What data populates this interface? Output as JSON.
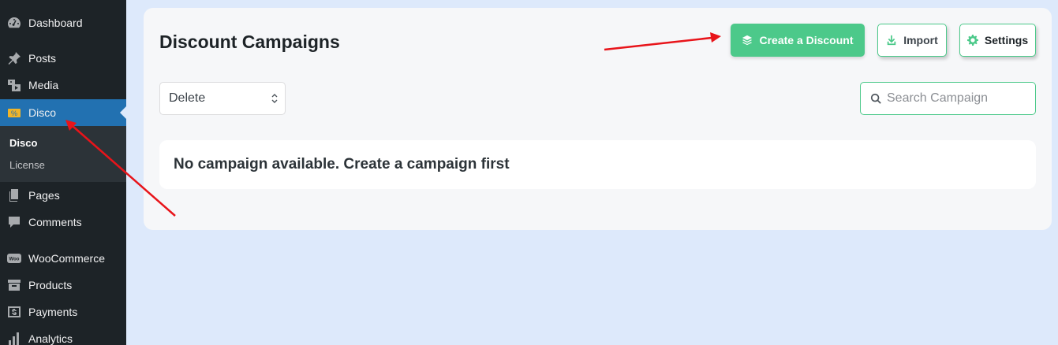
{
  "sidebar": {
    "items": [
      {
        "label": "Dashboard",
        "icon": "dashboard-icon"
      },
      {
        "label": "Posts",
        "icon": "pin-icon"
      },
      {
        "label": "Media",
        "icon": "media-icon"
      },
      {
        "label": "Disco",
        "icon": "disco-icon",
        "active": true
      },
      {
        "label": "Pages",
        "icon": "pages-icon"
      },
      {
        "label": "Comments",
        "icon": "comment-icon"
      },
      {
        "label": "WooCommerce",
        "icon": "woo-icon"
      },
      {
        "label": "Products",
        "icon": "archive-icon"
      },
      {
        "label": "Payments",
        "icon": "dollar-icon"
      },
      {
        "label": "Analytics",
        "icon": "chart-icon"
      }
    ],
    "submenu": [
      {
        "label": "Disco",
        "current": true
      },
      {
        "label": "License"
      }
    ]
  },
  "main": {
    "title": "Discount Campaigns",
    "buttons": {
      "create": "Create a Discount",
      "import": "Import",
      "settings": "Settings"
    },
    "bulk_action": {
      "selected": "Delete"
    },
    "search": {
      "placeholder": "Search Campaign"
    },
    "empty_message": "No campaign available. Create a campaign first"
  },
  "colors": {
    "sidebar_bg": "#1d2327",
    "active_bg": "#2271b1",
    "accent_green": "#4cc98a",
    "page_bg": "#dde9fb",
    "annotation_red": "#e8141a"
  }
}
